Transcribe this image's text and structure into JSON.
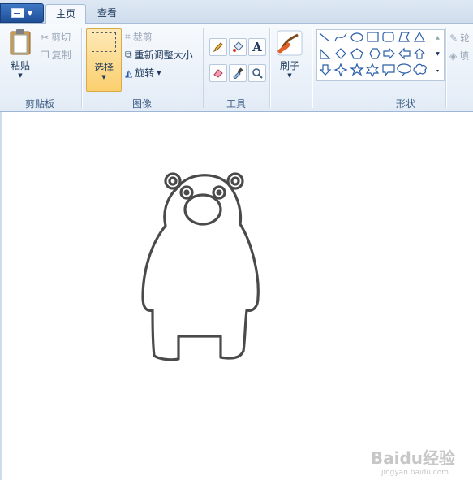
{
  "tabs": [
    {
      "label": "主页",
      "active": true
    },
    {
      "label": "查看",
      "active": false
    }
  ],
  "clipboard": {
    "paste_label": "粘贴",
    "cut_label": "剪切",
    "copy_label": "复制",
    "group_label": "剪贴板"
  },
  "image": {
    "select_label": "选择",
    "crop_label": "裁剪",
    "resize_label": "重新调整大小",
    "rotate_label": "旋转",
    "group_label": "图像"
  },
  "tools": {
    "group_label": "工具",
    "text_tool_glyph": "A"
  },
  "brushes": {
    "label": "刷子"
  },
  "shapes": {
    "group_label": "形状",
    "outline_label": "轮",
    "fill_label": "填"
  },
  "watermark": {
    "text": "Baidu经验",
    "sub": "jingyan.baidu.com"
  },
  "colors": {
    "accent": "#2b5ea7",
    "ribbon": "#e2ebf6",
    "select_active": "#fcd98b"
  }
}
